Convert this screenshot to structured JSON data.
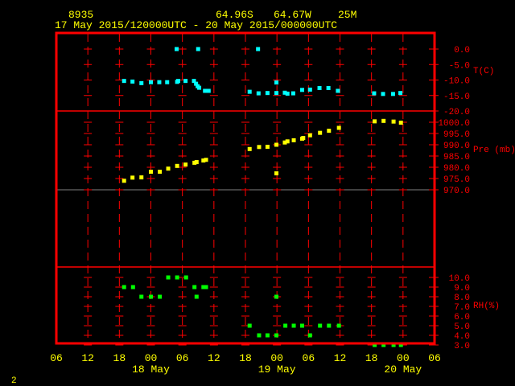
{
  "header": {
    "station": "8935",
    "lat": "64.96S",
    "lon": "64.67W",
    "elev": "25M",
    "time_range": "17 May 2015/120000UTC - 20 May 2015/000000UTC"
  },
  "footer": {
    "page": "2"
  },
  "colors": {
    "frame": "#ff0000",
    "temp": "#00ffff",
    "pressure": "#ffff00",
    "rh": "#00ff00",
    "text": "#ffff00",
    "zero_line": "#808080"
  },
  "chart_data": {
    "type": "scatter",
    "x_units": "hours since 17 May 2015 06 UTC",
    "xlim": [
      0,
      72
    ],
    "x_ticks": [
      {
        "h": 0,
        "label": "06"
      },
      {
        "h": 6,
        "label": "12"
      },
      {
        "h": 12,
        "label": "18"
      },
      {
        "h": 18,
        "label": "00"
      },
      {
        "h": 24,
        "label": "06"
      },
      {
        "h": 30,
        "label": "12"
      },
      {
        "h": 36,
        "label": "18"
      },
      {
        "h": 42,
        "label": "00"
      },
      {
        "h": 48,
        "label": "06"
      },
      {
        "h": 54,
        "label": "12"
      },
      {
        "h": 60,
        "label": "18"
      },
      {
        "h": 66,
        "label": "00"
      },
      {
        "h": 72,
        "label": "06"
      }
    ],
    "date_labels": [
      {
        "h": 18,
        "label": "18 May"
      },
      {
        "h": 42,
        "label": "19 May"
      },
      {
        "h": 66,
        "label": "20 May"
      }
    ],
    "panels": [
      {
        "name": "temperature",
        "ylabel": "T(C)",
        "ylim": [
          -20,
          0
        ],
        "ticks": [
          "0.0",
          "-5.0",
          "-10.0",
          "-15.0",
          "-20.0"
        ],
        "tick_values": [
          0,
          -5,
          -10,
          -15,
          -20
        ],
        "points": [
          [
            12.9,
            -10.3
          ],
          [
            14.5,
            -10.5
          ],
          [
            16.2,
            -11
          ],
          [
            18,
            -10.7
          ],
          [
            19.6,
            -10.7
          ],
          [
            21.1,
            -10.7
          ],
          [
            23,
            -10.6
          ],
          [
            23.2,
            -10.3
          ],
          [
            24.6,
            -10.3
          ],
          [
            26.2,
            -10.3
          ],
          [
            26.6,
            -11.2
          ],
          [
            26.9,
            -12
          ],
          [
            27.2,
            -12.5
          ],
          [
            28.3,
            -13.5
          ],
          [
            29,
            -13.5
          ],
          [
            22.9,
            0
          ],
          [
            27,
            0
          ],
          [
            38.4,
            0
          ],
          [
            36.8,
            -13.8
          ],
          [
            38.5,
            -14.3
          ],
          [
            40.2,
            -14.2
          ],
          [
            41.9,
            -14.2
          ],
          [
            41.9,
            -10.8
          ],
          [
            43.5,
            -14.1
          ],
          [
            44,
            -14.4
          ],
          [
            45.1,
            -14.3
          ],
          [
            46.8,
            -13.2
          ],
          [
            48.3,
            -13.1
          ],
          [
            50.1,
            -12.6
          ],
          [
            51.8,
            -12.6
          ],
          [
            53.6,
            -13.5
          ],
          [
            60.5,
            -14.3
          ],
          [
            62.2,
            -14.5
          ],
          [
            64.1,
            -14.5
          ],
          [
            65.5,
            -14.2
          ]
        ]
      },
      {
        "name": "pressure",
        "ylabel": "Pre (mb)",
        "ylim": [
          970,
          1000
        ],
        "ticks": [
          "1000.0",
          "995.0",
          "990.0",
          "985.0",
          "980.0",
          "975.0",
          "970.0"
        ],
        "tick_values": [
          1000,
          995,
          990,
          985,
          980,
          975,
          970
        ],
        "points": [
          [
            12.9,
            974
          ],
          [
            14.5,
            975.4
          ],
          [
            16.2,
            975.5
          ],
          [
            18,
            978
          ],
          [
            19.7,
            978
          ],
          [
            21.3,
            979.4
          ],
          [
            23,
            980.6
          ],
          [
            24.6,
            981.2
          ],
          [
            26.3,
            982
          ],
          [
            26.7,
            982.3
          ],
          [
            28,
            983
          ],
          [
            28.5,
            983.3
          ],
          [
            36.8,
            988.1
          ],
          [
            38.6,
            989
          ],
          [
            40.2,
            989.1
          ],
          [
            41.9,
            990
          ],
          [
            41.9,
            977.3
          ],
          [
            43.5,
            991
          ],
          [
            44,
            991.5
          ],
          [
            45.2,
            992
          ],
          [
            46.8,
            992.7
          ],
          [
            47,
            993
          ],
          [
            48.3,
            994.2
          ],
          [
            50.2,
            995.3
          ],
          [
            51.9,
            996.2
          ],
          [
            53.8,
            997.5
          ],
          [
            60.6,
            1000.4
          ],
          [
            62.3,
            1000.6
          ],
          [
            64.2,
            1000.3
          ],
          [
            65.6,
            999.8
          ]
        ]
      },
      {
        "name": "relative_humidity",
        "ylabel": "RH(%)",
        "ylim": [
          3,
          10
        ],
        "ticks": [
          "10.0",
          "9.0",
          "8.0",
          "7.0",
          "6.0",
          "5.0",
          "4.0",
          "3.0"
        ],
        "tick_values": [
          10,
          9,
          8,
          7,
          6,
          5,
          4,
          3
        ],
        "points": [
          [
            12.9,
            9
          ],
          [
            14.6,
            9
          ],
          [
            16.2,
            8
          ],
          [
            18,
            8
          ],
          [
            19.7,
            8
          ],
          [
            21.3,
            10
          ],
          [
            23,
            10
          ],
          [
            24.7,
            10
          ],
          [
            26.3,
            9
          ],
          [
            26.7,
            8
          ],
          [
            28,
            9
          ],
          [
            28.5,
            9
          ],
          [
            36.8,
            5
          ],
          [
            38.6,
            4
          ],
          [
            40.2,
            4
          ],
          [
            41.9,
            4
          ],
          [
            41.9,
            8
          ],
          [
            43.6,
            5
          ],
          [
            45.2,
            5
          ],
          [
            46.8,
            5
          ],
          [
            48.3,
            4
          ],
          [
            50.2,
            5
          ],
          [
            51.9,
            5
          ],
          [
            53.8,
            5
          ],
          [
            60.6,
            3
          ],
          [
            62.3,
            3
          ],
          [
            64.2,
            3
          ],
          [
            65.6,
            3
          ]
        ]
      }
    ]
  }
}
